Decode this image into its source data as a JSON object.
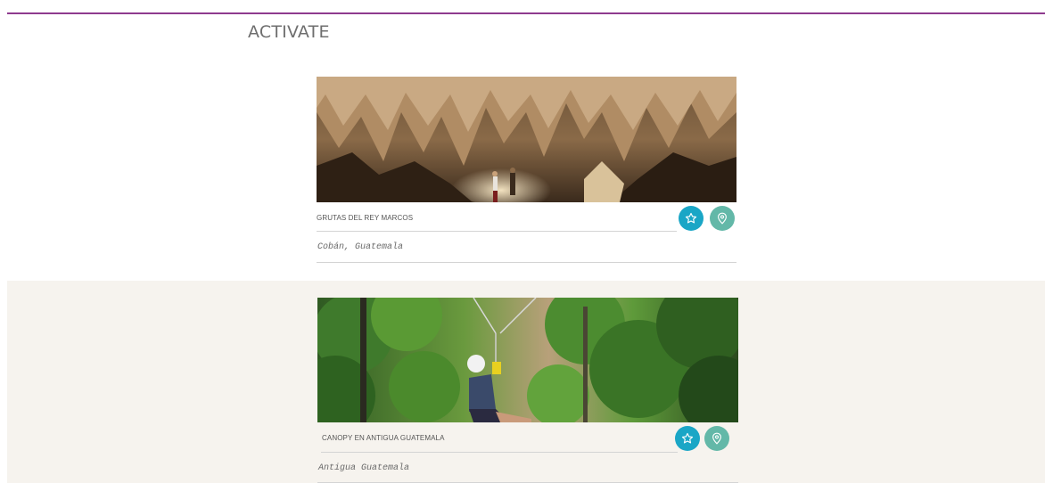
{
  "section": {
    "title": "ACTIVATE"
  },
  "cards": [
    {
      "name": "GRUTAS DEL REY MARCOS",
      "location": "Cobán, Guatemala",
      "image": "cave-photo"
    },
    {
      "name": "CANOPY EN ANTIGUA GUATEMALA",
      "location": "Antigua Guatemala",
      "image": "zipline-jungle-photo"
    }
  ],
  "icons": {
    "favorite": "star-icon",
    "map": "map-pin-icon"
  },
  "colors": {
    "accent_rule": "#8e3a8e",
    "favorite_button": "#1aa6c6",
    "map_button": "#63b8a8",
    "band_background": "#f6f3ee"
  }
}
